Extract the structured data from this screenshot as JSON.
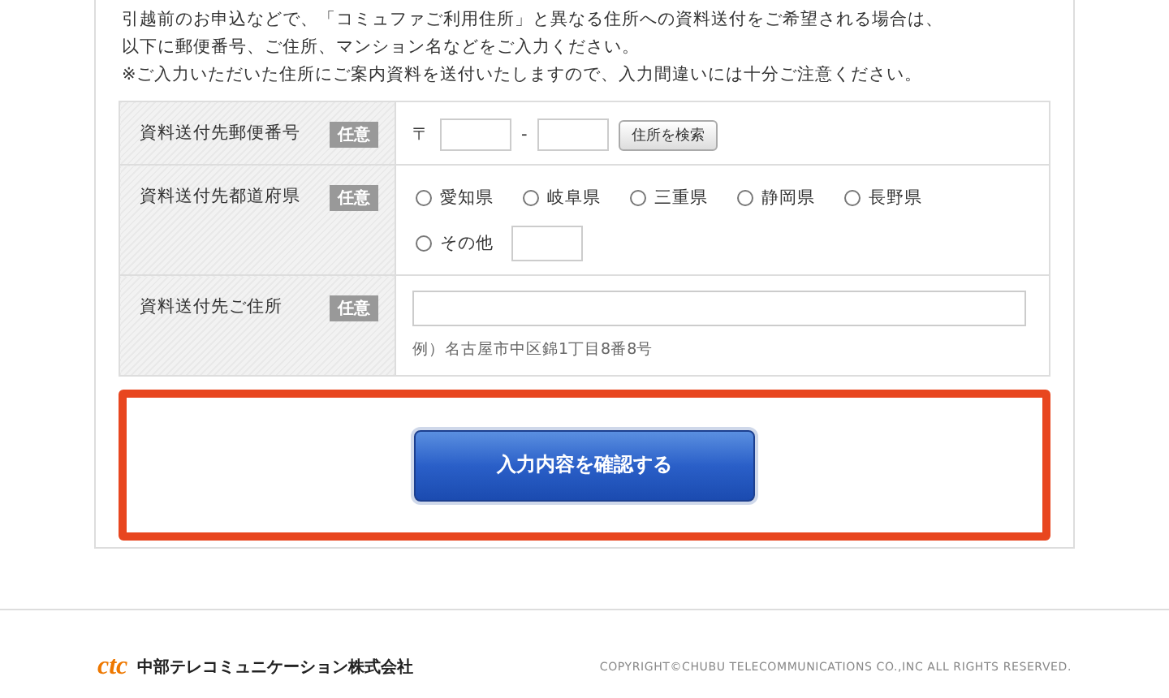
{
  "intro": [
    "引越前のお申込などで、「コミュファご利用住所」と異なる住所への資料送付をご希望される場合は、",
    "以下に郵便番号、ご住所、マンション名などをご入力ください。",
    "※ご入力いただいた住所にご案内資料を送付いたしますので、入力間違いには十分ご注意ください。"
  ],
  "rows": [
    {
      "label": "資料送付先郵便番号",
      "badge": "任意",
      "kind": "zip",
      "mark": "〒",
      "separator": "-",
      "search_button": "住所を検索"
    },
    {
      "label": "資料送付先都道府県",
      "badge": "任意",
      "kind": "prefecture",
      "options": [
        {
          "label": "愛知県",
          "selected": false
        },
        {
          "label": "岐阜県",
          "selected": false
        },
        {
          "label": "三重県",
          "selected": false
        },
        {
          "label": "静岡県",
          "selected": false
        },
        {
          "label": "長野県",
          "selected": false
        },
        {
          "label": "その他",
          "selected": false,
          "has_field": true
        }
      ]
    },
    {
      "label": "資料送付先ご住所",
      "badge": "任意",
      "kind": "address",
      "example": "例）名古屋市中区錦1丁目8番8号"
    }
  ],
  "confirm_button": "入力内容を確認する",
  "footer": {
    "logo": "ctc",
    "company": "中部テレコミュニケーション株式会社",
    "copyright": "COPYRIGHT©CHUBU TELECOMMUNICATIONS CO.,INC ALL RIGHTS RESERVED."
  }
}
